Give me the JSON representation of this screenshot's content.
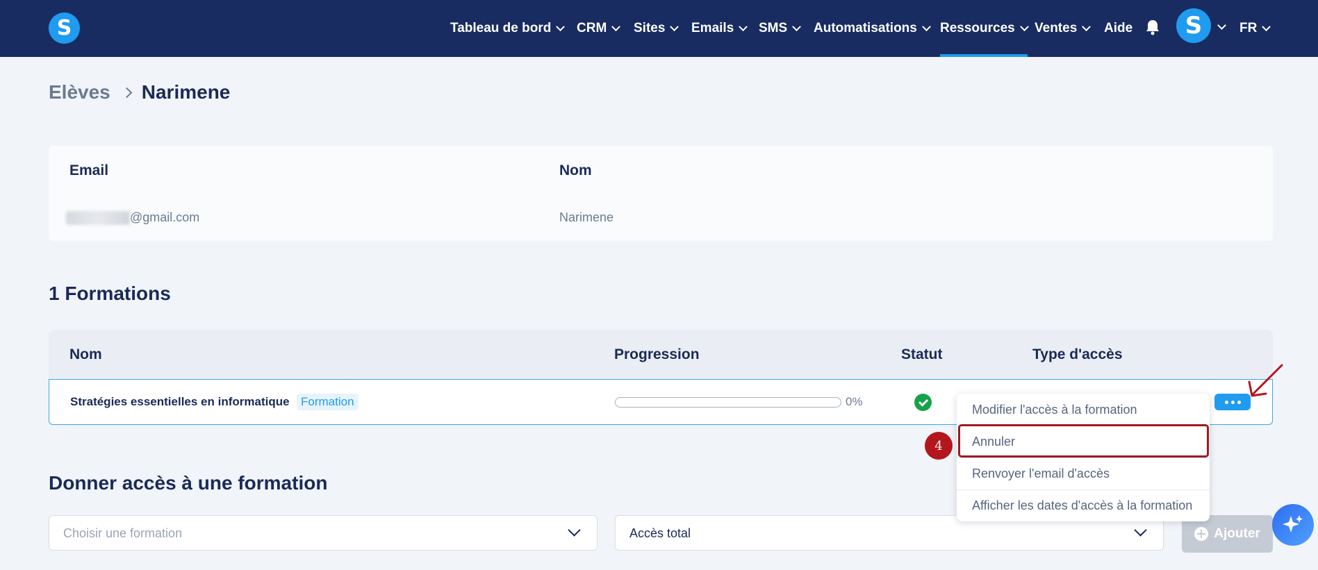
{
  "brand": {
    "logo_letter": "S",
    "accent": "#1f9bf0",
    "nav_bg": "#182c61"
  },
  "nav": {
    "items": [
      {
        "label": "Tableau de bord",
        "dropdown": true
      },
      {
        "label": "CRM",
        "dropdown": true
      },
      {
        "label": "Sites",
        "dropdown": true
      },
      {
        "label": "Emails",
        "dropdown": true
      },
      {
        "label": "SMS",
        "dropdown": true
      },
      {
        "label": "Automatisations",
        "dropdown": true
      },
      {
        "label": "Ressources",
        "dropdown": true,
        "active": true
      },
      {
        "label": "Ventes",
        "dropdown": true
      },
      {
        "label": "Aide",
        "dropdown": false
      }
    ],
    "bell_icon": "bell-icon",
    "avatar_letter": "S",
    "language": "FR"
  },
  "breadcrumb": {
    "parent": "Elèves",
    "current": "Narimene"
  },
  "student": {
    "email_label": "Email",
    "email_value": "@gmail.com",
    "name_label": "Nom",
    "name_value": "Narimene"
  },
  "formations": {
    "title": "1 Formations",
    "headers": {
      "name": "Nom",
      "progress": "Progression",
      "status": "Statut",
      "access_type": "Type d'accès"
    },
    "rows": [
      {
        "name": "Stratégies essentielles en informatique",
        "badge": "Formation",
        "progress_pct": 0,
        "progress_label": "0%",
        "status": "active",
        "status_color": "#15a24a"
      }
    ]
  },
  "menu": {
    "items": [
      "Modifier l'accès à la formation",
      "Annuler",
      "Renvoyer l'email d'accès",
      "Afficher les dates d'accès à la formation"
    ],
    "highlighted_index": 1,
    "step_number": "4"
  },
  "give_access": {
    "title": "Donner accès à une formation",
    "formation_placeholder": "Choisir une formation",
    "access_value": "Accès total",
    "add_label": "Ajouter"
  }
}
